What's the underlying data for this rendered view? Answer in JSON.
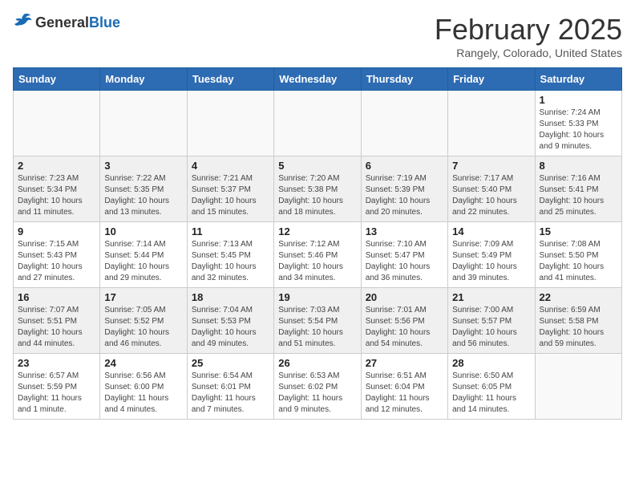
{
  "header": {
    "logo": {
      "general": "General",
      "blue": "Blue"
    },
    "title": "February 2025",
    "location": "Rangely, Colorado, United States"
  },
  "days_of_week": [
    "Sunday",
    "Monday",
    "Tuesday",
    "Wednesday",
    "Thursday",
    "Friday",
    "Saturday"
  ],
  "weeks": [
    [
      {
        "day": "",
        "info": ""
      },
      {
        "day": "",
        "info": ""
      },
      {
        "day": "",
        "info": ""
      },
      {
        "day": "",
        "info": ""
      },
      {
        "day": "",
        "info": ""
      },
      {
        "day": "",
        "info": ""
      },
      {
        "day": "1",
        "info": "Sunrise: 7:24 AM\nSunset: 5:33 PM\nDaylight: 10 hours and 9 minutes."
      }
    ],
    [
      {
        "day": "2",
        "info": "Sunrise: 7:23 AM\nSunset: 5:34 PM\nDaylight: 10 hours and 11 minutes."
      },
      {
        "day": "3",
        "info": "Sunrise: 7:22 AM\nSunset: 5:35 PM\nDaylight: 10 hours and 13 minutes."
      },
      {
        "day": "4",
        "info": "Sunrise: 7:21 AM\nSunset: 5:37 PM\nDaylight: 10 hours and 15 minutes."
      },
      {
        "day": "5",
        "info": "Sunrise: 7:20 AM\nSunset: 5:38 PM\nDaylight: 10 hours and 18 minutes."
      },
      {
        "day": "6",
        "info": "Sunrise: 7:19 AM\nSunset: 5:39 PM\nDaylight: 10 hours and 20 minutes."
      },
      {
        "day": "7",
        "info": "Sunrise: 7:17 AM\nSunset: 5:40 PM\nDaylight: 10 hours and 22 minutes."
      },
      {
        "day": "8",
        "info": "Sunrise: 7:16 AM\nSunset: 5:41 PM\nDaylight: 10 hours and 25 minutes."
      }
    ],
    [
      {
        "day": "9",
        "info": "Sunrise: 7:15 AM\nSunset: 5:43 PM\nDaylight: 10 hours and 27 minutes."
      },
      {
        "day": "10",
        "info": "Sunrise: 7:14 AM\nSunset: 5:44 PM\nDaylight: 10 hours and 29 minutes."
      },
      {
        "day": "11",
        "info": "Sunrise: 7:13 AM\nSunset: 5:45 PM\nDaylight: 10 hours and 32 minutes."
      },
      {
        "day": "12",
        "info": "Sunrise: 7:12 AM\nSunset: 5:46 PM\nDaylight: 10 hours and 34 minutes."
      },
      {
        "day": "13",
        "info": "Sunrise: 7:10 AM\nSunset: 5:47 PM\nDaylight: 10 hours and 36 minutes."
      },
      {
        "day": "14",
        "info": "Sunrise: 7:09 AM\nSunset: 5:49 PM\nDaylight: 10 hours and 39 minutes."
      },
      {
        "day": "15",
        "info": "Sunrise: 7:08 AM\nSunset: 5:50 PM\nDaylight: 10 hours and 41 minutes."
      }
    ],
    [
      {
        "day": "16",
        "info": "Sunrise: 7:07 AM\nSunset: 5:51 PM\nDaylight: 10 hours and 44 minutes."
      },
      {
        "day": "17",
        "info": "Sunrise: 7:05 AM\nSunset: 5:52 PM\nDaylight: 10 hours and 46 minutes."
      },
      {
        "day": "18",
        "info": "Sunrise: 7:04 AM\nSunset: 5:53 PM\nDaylight: 10 hours and 49 minutes."
      },
      {
        "day": "19",
        "info": "Sunrise: 7:03 AM\nSunset: 5:54 PM\nDaylight: 10 hours and 51 minutes."
      },
      {
        "day": "20",
        "info": "Sunrise: 7:01 AM\nSunset: 5:56 PM\nDaylight: 10 hours and 54 minutes."
      },
      {
        "day": "21",
        "info": "Sunrise: 7:00 AM\nSunset: 5:57 PM\nDaylight: 10 hours and 56 minutes."
      },
      {
        "day": "22",
        "info": "Sunrise: 6:59 AM\nSunset: 5:58 PM\nDaylight: 10 hours and 59 minutes."
      }
    ],
    [
      {
        "day": "23",
        "info": "Sunrise: 6:57 AM\nSunset: 5:59 PM\nDaylight: 11 hours and 1 minute."
      },
      {
        "day": "24",
        "info": "Sunrise: 6:56 AM\nSunset: 6:00 PM\nDaylight: 11 hours and 4 minutes."
      },
      {
        "day": "25",
        "info": "Sunrise: 6:54 AM\nSunset: 6:01 PM\nDaylight: 11 hours and 7 minutes."
      },
      {
        "day": "26",
        "info": "Sunrise: 6:53 AM\nSunset: 6:02 PM\nDaylight: 11 hours and 9 minutes."
      },
      {
        "day": "27",
        "info": "Sunrise: 6:51 AM\nSunset: 6:04 PM\nDaylight: 11 hours and 12 minutes."
      },
      {
        "day": "28",
        "info": "Sunrise: 6:50 AM\nSunset: 6:05 PM\nDaylight: 11 hours and 14 minutes."
      },
      {
        "day": "",
        "info": ""
      }
    ]
  ]
}
